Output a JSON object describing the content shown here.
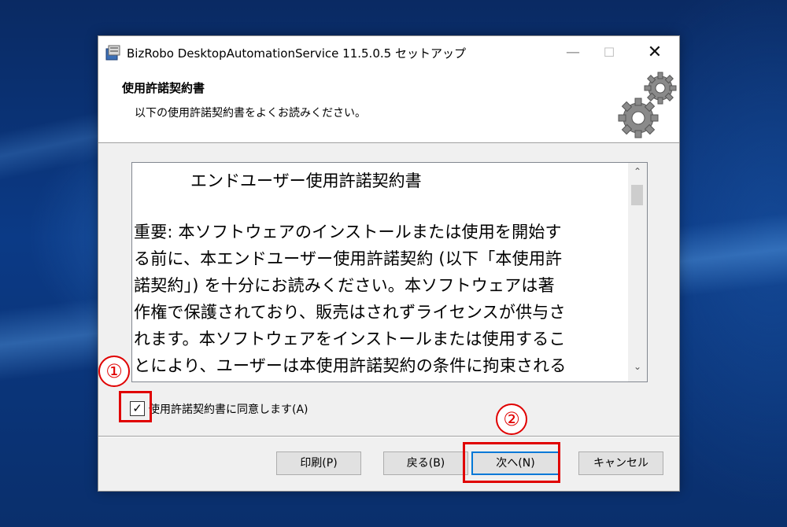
{
  "window": {
    "title": "BizRobo DesktopAutomationService 11.5.0.5 セットアップ",
    "minimize": "—",
    "maximize": "☐",
    "close": "✕"
  },
  "header": {
    "title": "使用許諾契約書",
    "subtitle": "以下の使用許諾契約書をよくお読みください。",
    "icon": "gears-icon"
  },
  "eula": {
    "heading": "エンドユーザー使用許諾契約書",
    "lines": [
      "重要: 本ソフトウェアのインストールまたは使用を開始す",
      "る前に、本エンドユーザー使用許諾契約 (以下「本使用許",
      "諾契約」) を十分にお読みください。本ソフトウェアは著",
      "作権で保護されており、販売はされずライセンスが供与さ",
      "れます。本ソフトウェアをインストールまたは使用するこ",
      "とにより、ユーザーは本使用許諾契約の条件に拘束される"
    ],
    "scroll_up": "⌃",
    "scroll_down": "⌄"
  },
  "agree": {
    "checked": true,
    "check_mark": "✓",
    "label": "使用許諾契約書に同意します(A)"
  },
  "buttons": {
    "print": "印刷(P)",
    "back": "戻る(B)",
    "next": "次へ(N)",
    "cancel": "キャンセル"
  },
  "annotations": {
    "marker1": "①",
    "marker2": "②",
    "color": "#e00000"
  }
}
